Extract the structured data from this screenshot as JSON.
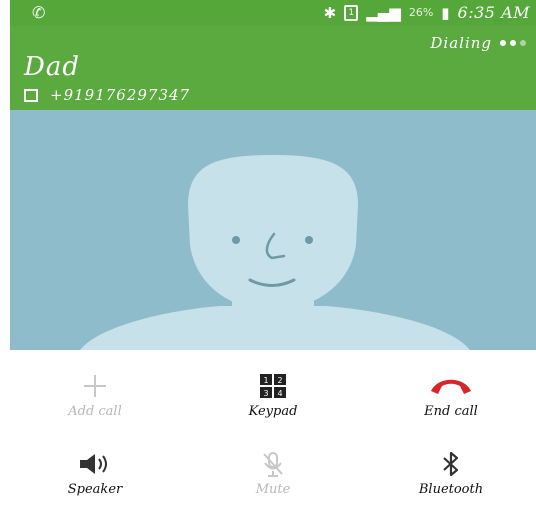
{
  "status_bar": {
    "battery_percent": "26%",
    "time": "6:35 AM"
  },
  "call": {
    "state": "Dialing",
    "contact_name": "Dad",
    "number": "+919176297347"
  },
  "controls": [
    {
      "label": "Add call",
      "enabled": false
    },
    {
      "label": "Keypad",
      "enabled": true
    },
    {
      "label": "End call",
      "enabled": true
    },
    {
      "label": "Speaker",
      "enabled": true
    },
    {
      "label": "Mute",
      "enabled": false
    },
    {
      "label": "Bluetooth",
      "enabled": true
    }
  ],
  "colors": {
    "header_green": "#5aaa3f",
    "avatar_background": "#8fbccb",
    "avatar_face": "#c7e1ea",
    "end_call_red": "#d7262b"
  },
  "icons": [
    "phone-icon",
    "bluetooth-icon",
    "sim-icon",
    "signal-icon",
    "battery-icon",
    "plus-icon",
    "keypad-icon",
    "end-call-icon",
    "speaker-icon",
    "mute-icon",
    "bluetooth-icon"
  ]
}
